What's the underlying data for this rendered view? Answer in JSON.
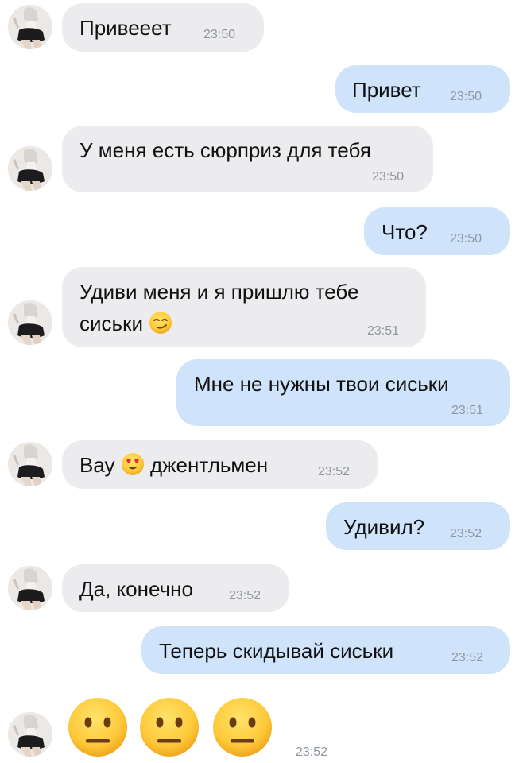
{
  "messages": [
    {
      "sender": "contact",
      "text": "Привееет",
      "time": "23:50"
    },
    {
      "sender": "me",
      "text": "Привет",
      "time": "23:50"
    },
    {
      "sender": "contact",
      "text": "У меня есть сюрприз для тебя",
      "time": "23:50"
    },
    {
      "sender": "me",
      "text": "Что?",
      "time": "23:50"
    },
    {
      "sender": "contact",
      "text_line1": "Удиви меня и я пришлю тебе",
      "text_line2": "сиськи",
      "emoji": "smirking-face",
      "time": "23:51"
    },
    {
      "sender": "me",
      "text": "Мне не нужны твои сиськи",
      "time": "23:51"
    },
    {
      "sender": "contact",
      "text_before": "Вау",
      "emoji": "heart-eyes-face",
      "text_after": "джентльмен",
      "time": "23:52"
    },
    {
      "sender": "me",
      "text": "Удивил?",
      "time": "23:52"
    },
    {
      "sender": "contact",
      "text": "Да, конечно",
      "time": "23:52"
    },
    {
      "sender": "me",
      "text": "Теперь скидывай сиськи",
      "time": "23:52"
    },
    {
      "sender": "contact",
      "emojis": [
        "neutral-face",
        "neutral-face",
        "neutral-face"
      ],
      "time": "23:52"
    }
  ],
  "colors": {
    "incoming_bubble": "#ececef",
    "outgoing_bubble": "#cfe3fb",
    "timestamp": "#8e96a0",
    "emoji_yellow": "#fdcb3f"
  }
}
